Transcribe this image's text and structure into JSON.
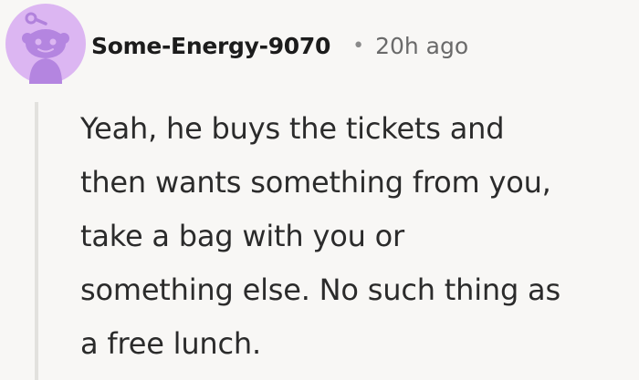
{
  "comment": {
    "avatar": {
      "icon": "snoo-avatar-icon",
      "background_color": "#d9b3f0",
      "figure_color": "#b485e0"
    },
    "username": "Some-Energy-9070",
    "separator": "•",
    "timestamp": "20h ago",
    "body_lines": [
      "Yeah, he buys the tickets and",
      "then wants something from you,",
      "take a bag with you or",
      "something else. No such thing as",
      "a free lunch."
    ]
  }
}
